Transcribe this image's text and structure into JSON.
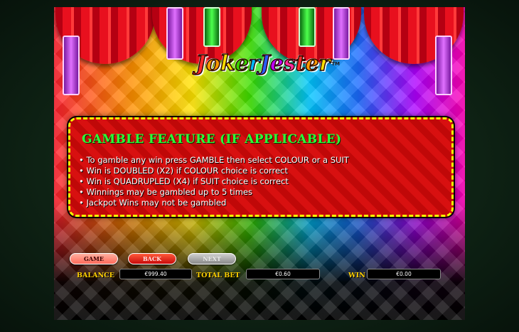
{
  "logo": {
    "text": "JokerJester",
    "tm": "TM"
  },
  "panel": {
    "title": "GAMBLE FEATURE (IF APPLICABLE)",
    "rules": [
      "To gamble any win press GAMBLE then select COLOUR or a SUIT",
      "Win is DOUBLED (X2) if COLOUR choice is correct",
      "Win is QUADRUPLED (X4) if SUIT choice is correct",
      "Winnings may be gambled up to 5 times",
      "Jackpot Wins may not be gambled"
    ]
  },
  "nav": {
    "game": "GAME",
    "back": "BACK",
    "next": "NEXT"
  },
  "status": {
    "balance_label": "BALANCE",
    "balance": "€999.40",
    "total_bet_label": "TOTAL BET",
    "total_bet": "€0.60",
    "win_label": "WIN",
    "win": "€0.00"
  },
  "colors": {
    "panel_red": "#d00000",
    "title_green": "#2dff3a",
    "label_gold": "#ffd000",
    "border_yellow": "#f7ff00"
  }
}
